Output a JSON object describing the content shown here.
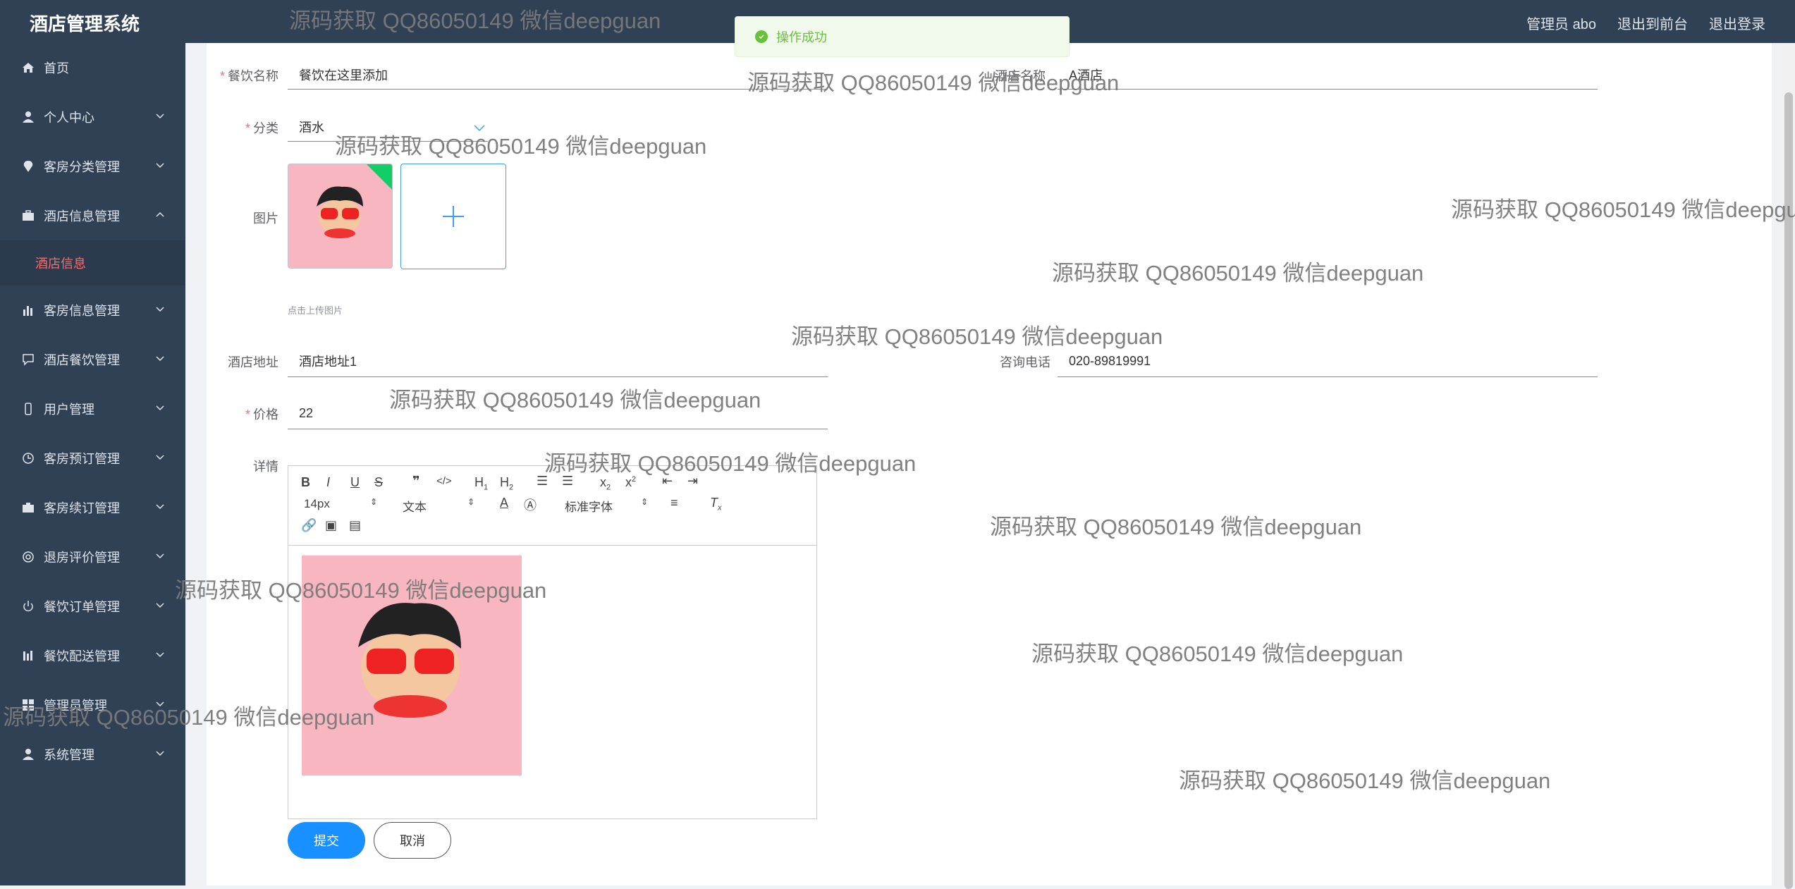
{
  "app": {
    "title": "酒店管理系统"
  },
  "topnav": {
    "user": "管理员 abo",
    "front": "退出到前台",
    "logout": "退出登录"
  },
  "sidebar": {
    "items": [
      {
        "label": "首页",
        "icon": "home-icon"
      },
      {
        "label": "个人中心",
        "icon": "user-icon"
      },
      {
        "label": "客房分类管理",
        "icon": "location-icon"
      },
      {
        "label": "酒店信息管理",
        "icon": "briefcase-icon",
        "expanded": true,
        "sub": "酒店信息"
      },
      {
        "label": "客房信息管理",
        "icon": "chart-icon"
      },
      {
        "label": "酒店餐饮管理",
        "icon": "chat-icon"
      },
      {
        "label": "用户管理",
        "icon": "phone-icon"
      },
      {
        "label": "客房预订管理",
        "icon": "clock-icon"
      },
      {
        "label": "客房续订管理",
        "icon": "suitcase-icon"
      },
      {
        "label": "退房评价管理",
        "icon": "circle-icon"
      },
      {
        "label": "餐饮订单管理",
        "icon": "power-icon"
      },
      {
        "label": "餐饮配送管理",
        "icon": "bars-icon"
      },
      {
        "label": "管理员管理",
        "icon": "grid-icon"
      },
      {
        "label": "系统管理",
        "icon": "user-icon"
      }
    ]
  },
  "toast": {
    "text": "操作成功",
    "color": "#67c23a"
  },
  "form": {
    "name_label": "餐饮名称",
    "name_value": "餐饮在这里添加",
    "hotel_label": "酒店名称",
    "hotel_value": "A酒店",
    "category_label": "分类",
    "category_value": "酒水",
    "image_label": "图片",
    "upload_hint": "点击上传图片",
    "address_label": "酒店地址",
    "address_value": "酒店地址1",
    "phone_label": "咨询电话",
    "phone_value": "020-89819991",
    "price_label": "价格",
    "price_value": "22",
    "detail_label": "详情"
  },
  "editor": {
    "font_size": "14px",
    "text_style": "文本",
    "font_family": "标准字体"
  },
  "buttons": {
    "submit": "提交",
    "cancel": "取消"
  },
  "watermark": {
    "text": "源码获取 QQ86050149 微信deepguan"
  },
  "colors": {
    "sidebar": "#304156",
    "primary": "#1890ff",
    "active_sub": "#ff6b6b",
    "required": "#f56c6c"
  }
}
